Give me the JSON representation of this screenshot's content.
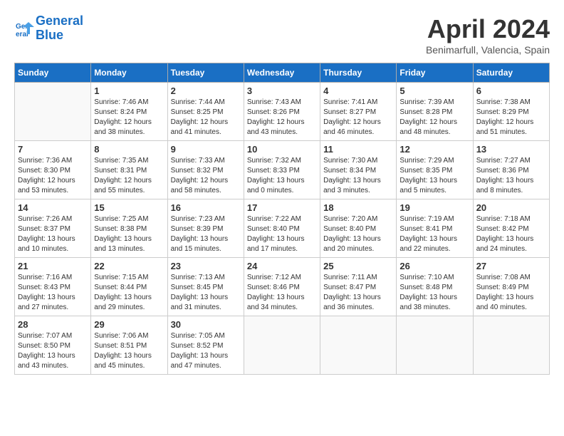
{
  "header": {
    "logo_line1": "General",
    "logo_line2": "Blue",
    "month": "April 2024",
    "location": "Benimarfull, Valencia, Spain"
  },
  "days_of_week": [
    "Sunday",
    "Monday",
    "Tuesday",
    "Wednesday",
    "Thursday",
    "Friday",
    "Saturday"
  ],
  "weeks": [
    [
      {
        "day": "",
        "info": ""
      },
      {
        "day": "1",
        "info": "Sunrise: 7:46 AM\nSunset: 8:24 PM\nDaylight: 12 hours\nand 38 minutes."
      },
      {
        "day": "2",
        "info": "Sunrise: 7:44 AM\nSunset: 8:25 PM\nDaylight: 12 hours\nand 41 minutes."
      },
      {
        "day": "3",
        "info": "Sunrise: 7:43 AM\nSunset: 8:26 PM\nDaylight: 12 hours\nand 43 minutes."
      },
      {
        "day": "4",
        "info": "Sunrise: 7:41 AM\nSunset: 8:27 PM\nDaylight: 12 hours\nand 46 minutes."
      },
      {
        "day": "5",
        "info": "Sunrise: 7:39 AM\nSunset: 8:28 PM\nDaylight: 12 hours\nand 48 minutes."
      },
      {
        "day": "6",
        "info": "Sunrise: 7:38 AM\nSunset: 8:29 PM\nDaylight: 12 hours\nand 51 minutes."
      }
    ],
    [
      {
        "day": "7",
        "info": "Sunrise: 7:36 AM\nSunset: 8:30 PM\nDaylight: 12 hours\nand 53 minutes."
      },
      {
        "day": "8",
        "info": "Sunrise: 7:35 AM\nSunset: 8:31 PM\nDaylight: 12 hours\nand 55 minutes."
      },
      {
        "day": "9",
        "info": "Sunrise: 7:33 AM\nSunset: 8:32 PM\nDaylight: 12 hours\nand 58 minutes."
      },
      {
        "day": "10",
        "info": "Sunrise: 7:32 AM\nSunset: 8:33 PM\nDaylight: 13 hours\nand 0 minutes."
      },
      {
        "day": "11",
        "info": "Sunrise: 7:30 AM\nSunset: 8:34 PM\nDaylight: 13 hours\nand 3 minutes."
      },
      {
        "day": "12",
        "info": "Sunrise: 7:29 AM\nSunset: 8:35 PM\nDaylight: 13 hours\nand 5 minutes."
      },
      {
        "day": "13",
        "info": "Sunrise: 7:27 AM\nSunset: 8:36 PM\nDaylight: 13 hours\nand 8 minutes."
      }
    ],
    [
      {
        "day": "14",
        "info": "Sunrise: 7:26 AM\nSunset: 8:37 PM\nDaylight: 13 hours\nand 10 minutes."
      },
      {
        "day": "15",
        "info": "Sunrise: 7:25 AM\nSunset: 8:38 PM\nDaylight: 13 hours\nand 13 minutes."
      },
      {
        "day": "16",
        "info": "Sunrise: 7:23 AM\nSunset: 8:39 PM\nDaylight: 13 hours\nand 15 minutes."
      },
      {
        "day": "17",
        "info": "Sunrise: 7:22 AM\nSunset: 8:40 PM\nDaylight: 13 hours\nand 17 minutes."
      },
      {
        "day": "18",
        "info": "Sunrise: 7:20 AM\nSunset: 8:40 PM\nDaylight: 13 hours\nand 20 minutes."
      },
      {
        "day": "19",
        "info": "Sunrise: 7:19 AM\nSunset: 8:41 PM\nDaylight: 13 hours\nand 22 minutes."
      },
      {
        "day": "20",
        "info": "Sunrise: 7:18 AM\nSunset: 8:42 PM\nDaylight: 13 hours\nand 24 minutes."
      }
    ],
    [
      {
        "day": "21",
        "info": "Sunrise: 7:16 AM\nSunset: 8:43 PM\nDaylight: 13 hours\nand 27 minutes."
      },
      {
        "day": "22",
        "info": "Sunrise: 7:15 AM\nSunset: 8:44 PM\nDaylight: 13 hours\nand 29 minutes."
      },
      {
        "day": "23",
        "info": "Sunrise: 7:13 AM\nSunset: 8:45 PM\nDaylight: 13 hours\nand 31 minutes."
      },
      {
        "day": "24",
        "info": "Sunrise: 7:12 AM\nSunset: 8:46 PM\nDaylight: 13 hours\nand 34 minutes."
      },
      {
        "day": "25",
        "info": "Sunrise: 7:11 AM\nSunset: 8:47 PM\nDaylight: 13 hours\nand 36 minutes."
      },
      {
        "day": "26",
        "info": "Sunrise: 7:10 AM\nSunset: 8:48 PM\nDaylight: 13 hours\nand 38 minutes."
      },
      {
        "day": "27",
        "info": "Sunrise: 7:08 AM\nSunset: 8:49 PM\nDaylight: 13 hours\nand 40 minutes."
      }
    ],
    [
      {
        "day": "28",
        "info": "Sunrise: 7:07 AM\nSunset: 8:50 PM\nDaylight: 13 hours\nand 43 minutes."
      },
      {
        "day": "29",
        "info": "Sunrise: 7:06 AM\nSunset: 8:51 PM\nDaylight: 13 hours\nand 45 minutes."
      },
      {
        "day": "30",
        "info": "Sunrise: 7:05 AM\nSunset: 8:52 PM\nDaylight: 13 hours\nand 47 minutes."
      },
      {
        "day": "",
        "info": ""
      },
      {
        "day": "",
        "info": ""
      },
      {
        "day": "",
        "info": ""
      },
      {
        "day": "",
        "info": ""
      }
    ]
  ]
}
